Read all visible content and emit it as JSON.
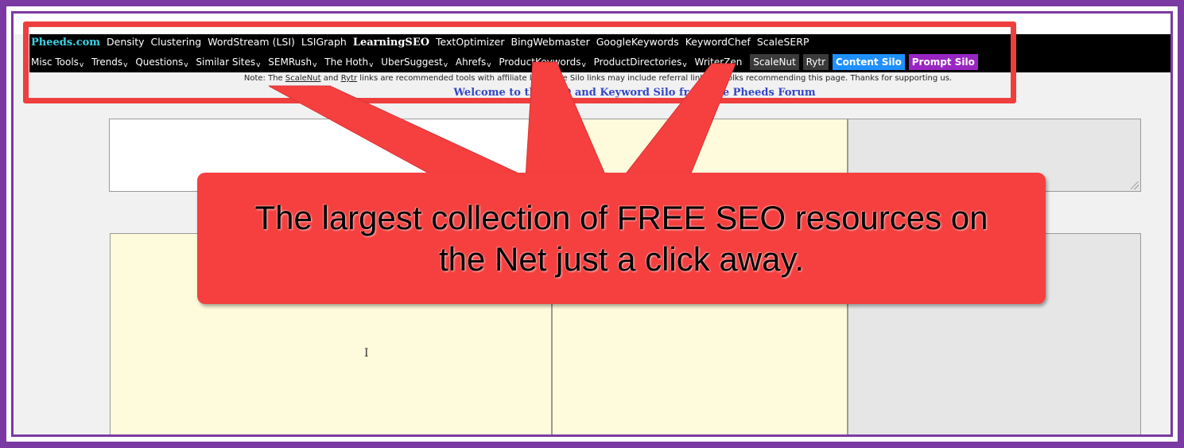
{
  "row1": {
    "brand": "Pheeds.com",
    "links": [
      "Density",
      "Clustering",
      "WordStream (LSI)",
      "LSIGraph"
    ],
    "bold_link": "LearningSEO",
    "links_after": [
      "TextOptimizer",
      "BingWebmaster",
      "GoogleKeywords",
      "KeywordChef",
      "ScaleSERP"
    ]
  },
  "nav": {
    "caret": "v",
    "dropdowns": [
      "Misc Tools",
      "Trends",
      "Questions",
      "Similar Sites",
      "SEMRush",
      "The Hoth",
      "UberSuggest",
      "Ahrefs",
      "ProductKeywords",
      "ProductDirectories"
    ],
    "writerzen": "WriterZen",
    "scalenut": "ScaleNut",
    "rytr": "Rytr",
    "content_silo": "Content Silo",
    "prompt_silo": "Prompt Silo"
  },
  "note": {
    "prefix": "Note: The",
    "scalenut": "ScaleNut",
    "and": "and",
    "rytr": "Rytr",
    "rest": "links are recommended tools with affiliate links. The Silo links may include referral links for folks recommending this page. Thanks for supporting us."
  },
  "welcome": "Welcome to the SEO and Keyword Silo from the Pheeds Forum",
  "callout": {
    "text": "The largest collection of FREE SEO resources on the Net just a click away."
  },
  "cursor_glyph": "I",
  "colors": {
    "frame": "#7b3aa3",
    "callout": "#f5403f",
    "brand": "#39d5e6",
    "content_silo": "#1e90ff",
    "prompt_silo": "#9a26c2",
    "welcome": "#3347c9"
  }
}
